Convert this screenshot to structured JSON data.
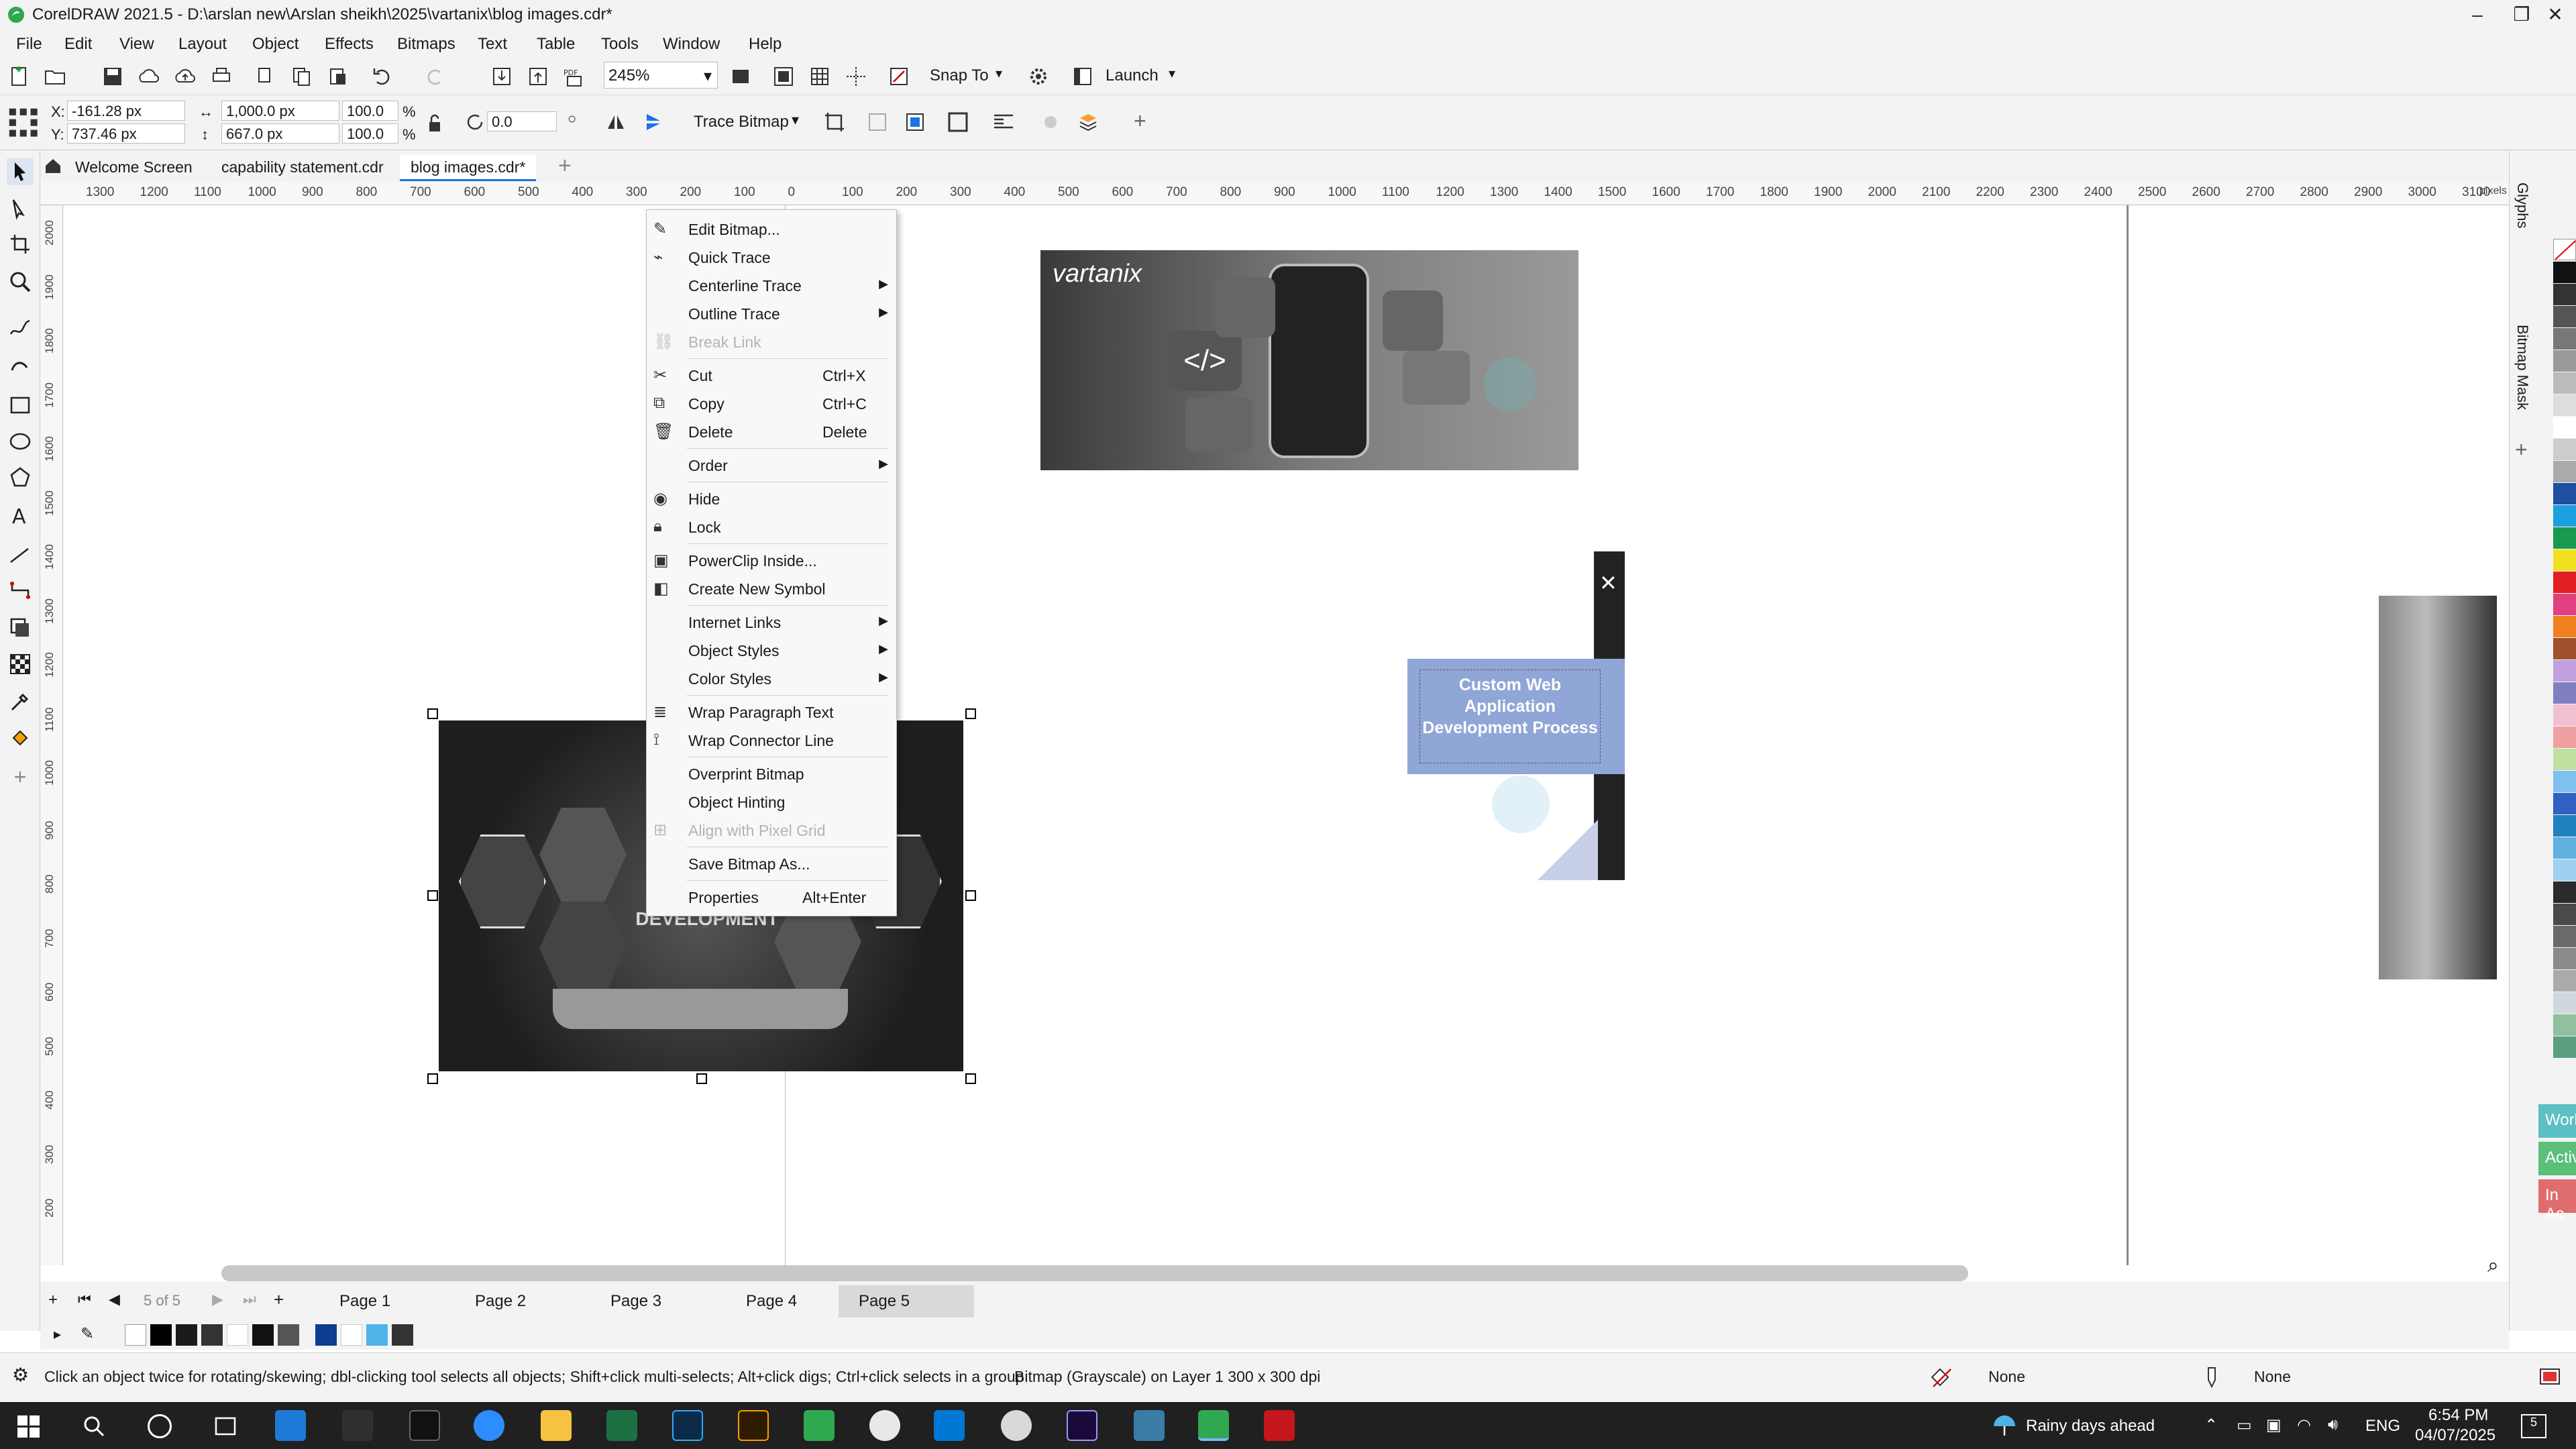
{
  "window": {
    "title": "CorelDRAW 2021.5 - D:\\arslan new\\Arslan sheikh\\2025\\vartanix\\blog images.cdr*"
  },
  "menu": [
    "File",
    "Edit",
    "View",
    "Layout",
    "Object",
    "Effects",
    "Bitmaps",
    "Text",
    "Table",
    "Tools",
    "Window",
    "Help"
  ],
  "toolbar": {
    "zoom_value": "245%",
    "snap_to_label": "Snap To",
    "launch_label": "Launch"
  },
  "propbar": {
    "x_label": "X:",
    "x_value": "-161.28 px",
    "y_label": "Y:",
    "y_value": "737.46 px",
    "width_value": "1,000.0 px",
    "height_value": "667.0 px",
    "scale_w": "100.0",
    "scale_h": "100.0",
    "pct": "%",
    "rotation": "0.0",
    "trace_bitmap_label": "Trace Bitmap"
  },
  "tabs": [
    "Welcome Screen",
    "capability statement.cdr",
    "blog images.cdr*"
  ],
  "ruler": {
    "h_ticks": [
      "1300",
      "1200",
      "1100",
      "1000",
      "900",
      "800",
      "700",
      "600",
      "500",
      "400",
      "300",
      "200",
      "100",
      "0",
      "100",
      "200",
      "300",
      "400",
      "500",
      "600",
      "700",
      "800",
      "900",
      "1000",
      "1100",
      "1200",
      "1300",
      "1400",
      "1500",
      "1600",
      "1700",
      "1800",
      "1900",
      "2000",
      "2100",
      "2200",
      "2300",
      "2400",
      "2500",
      "2600",
      "2700",
      "2800",
      "2900",
      "3000",
      "3100"
    ],
    "v_ticks": [
      "2000",
      "1900",
      "1800",
      "1700",
      "1600",
      "1500",
      "1400",
      "1300",
      "1200",
      "1100",
      "1000",
      "900",
      "800",
      "700",
      "600",
      "500",
      "400",
      "300",
      "200"
    ],
    "unit": "pixels"
  },
  "context_menu": {
    "items": [
      {
        "label": "Edit Bitmap...",
        "shortcut": "",
        "submenu": false,
        "disabled": false,
        "icon": "edit-bitmap-icon"
      },
      {
        "label": "Quick Trace",
        "shortcut": "",
        "submenu": false,
        "disabled": false,
        "icon": "quick-trace-icon"
      },
      {
        "label": "Centerline Trace",
        "shortcut": "",
        "submenu": true,
        "disabled": false,
        "icon": ""
      },
      {
        "label": "Outline Trace",
        "shortcut": "",
        "submenu": true,
        "disabled": false,
        "icon": ""
      },
      {
        "label": "Break Link",
        "shortcut": "",
        "submenu": false,
        "disabled": true,
        "icon": "break-link-icon"
      },
      {
        "label": "Cut",
        "shortcut": "Ctrl+X",
        "submenu": false,
        "disabled": false,
        "icon": "cut-icon"
      },
      {
        "label": "Copy",
        "shortcut": "Ctrl+C",
        "submenu": false,
        "disabled": false,
        "icon": "copy-icon"
      },
      {
        "label": "Delete",
        "shortcut": "Delete",
        "submenu": false,
        "disabled": false,
        "icon": "delete-icon"
      },
      {
        "label": "Order",
        "shortcut": "",
        "submenu": true,
        "disabled": false,
        "icon": ""
      },
      {
        "label": "Hide",
        "shortcut": "",
        "submenu": false,
        "disabled": false,
        "icon": "eye-icon"
      },
      {
        "label": "Lock",
        "shortcut": "",
        "submenu": false,
        "disabled": false,
        "icon": "lock-icon"
      },
      {
        "label": "PowerClip Inside...",
        "shortcut": "",
        "submenu": false,
        "disabled": false,
        "icon": "powerclip-icon"
      },
      {
        "label": "Create New Symbol",
        "shortcut": "",
        "submenu": false,
        "disabled": false,
        "icon": "symbol-icon"
      },
      {
        "label": "Internet Links",
        "shortcut": "",
        "submenu": true,
        "disabled": false,
        "icon": ""
      },
      {
        "label": "Object Styles",
        "shortcut": "",
        "submenu": true,
        "disabled": false,
        "icon": ""
      },
      {
        "label": "Color Styles",
        "shortcut": "",
        "submenu": true,
        "disabled": false,
        "icon": ""
      },
      {
        "label": "Wrap Paragraph Text",
        "shortcut": "",
        "submenu": false,
        "disabled": false,
        "icon": "wrap-text-icon"
      },
      {
        "label": "Wrap Connector Line",
        "shortcut": "",
        "submenu": false,
        "disabled": false,
        "icon": "wrap-connector-icon"
      },
      {
        "label": "Overprint Bitmap",
        "shortcut": "",
        "submenu": false,
        "disabled": false,
        "icon": ""
      },
      {
        "label": "Object Hinting",
        "shortcut": "",
        "submenu": false,
        "disabled": false,
        "icon": ""
      },
      {
        "label": "Align with Pixel Grid",
        "shortcut": "",
        "submenu": false,
        "disabled": true,
        "icon": "pixel-grid-icon"
      },
      {
        "label": "Save Bitmap As...",
        "shortcut": "",
        "submenu": false,
        "disabled": false,
        "icon": ""
      },
      {
        "label": "Properties",
        "shortcut": "Alt+Enter",
        "submenu": false,
        "disabled": false,
        "icon": ""
      }
    ]
  },
  "canvas": {
    "banner_logo": "vartanix",
    "card_text": "Custom Web Application Development Process",
    "hex_text": "DEVELOPMENT"
  },
  "docker_tabs": [
    "Glyphs",
    "Bitmap Mask"
  ],
  "side_badges": [
    "Work",
    "Activ",
    "In Ac"
  ],
  "pages": {
    "counter": "5 of 5",
    "items": [
      "Page 1",
      "Page 2",
      "Page 3",
      "Page 4",
      "Page 5"
    ],
    "active": "Page 5"
  },
  "status": {
    "hint": "Click an object twice for rotating/skewing; dbl-clicking tool selects all objects; Shift+click multi-selects; Alt+click digs; Ctrl+click selects in a group",
    "object_info": "Bitmap (Grayscale) on Layer 1 300 x 300 dpi",
    "fill": "None",
    "outline": "None"
  },
  "taskbar": {
    "weather": "Rainy days ahead",
    "lang": "ENG",
    "time": "6:54 PM",
    "date": "04/07/2025",
    "notifications": "5"
  },
  "colors": {
    "accent_blue": "#1a73e8",
    "menu_bg": "#f8f8f8",
    "page_tab_active": "#d9d9d9",
    "card_blue": "#8fa6d6",
    "badge_work": "#5bbfc3",
    "badge_active": "#5bbf7a",
    "badge_in": "#e06d6d"
  }
}
